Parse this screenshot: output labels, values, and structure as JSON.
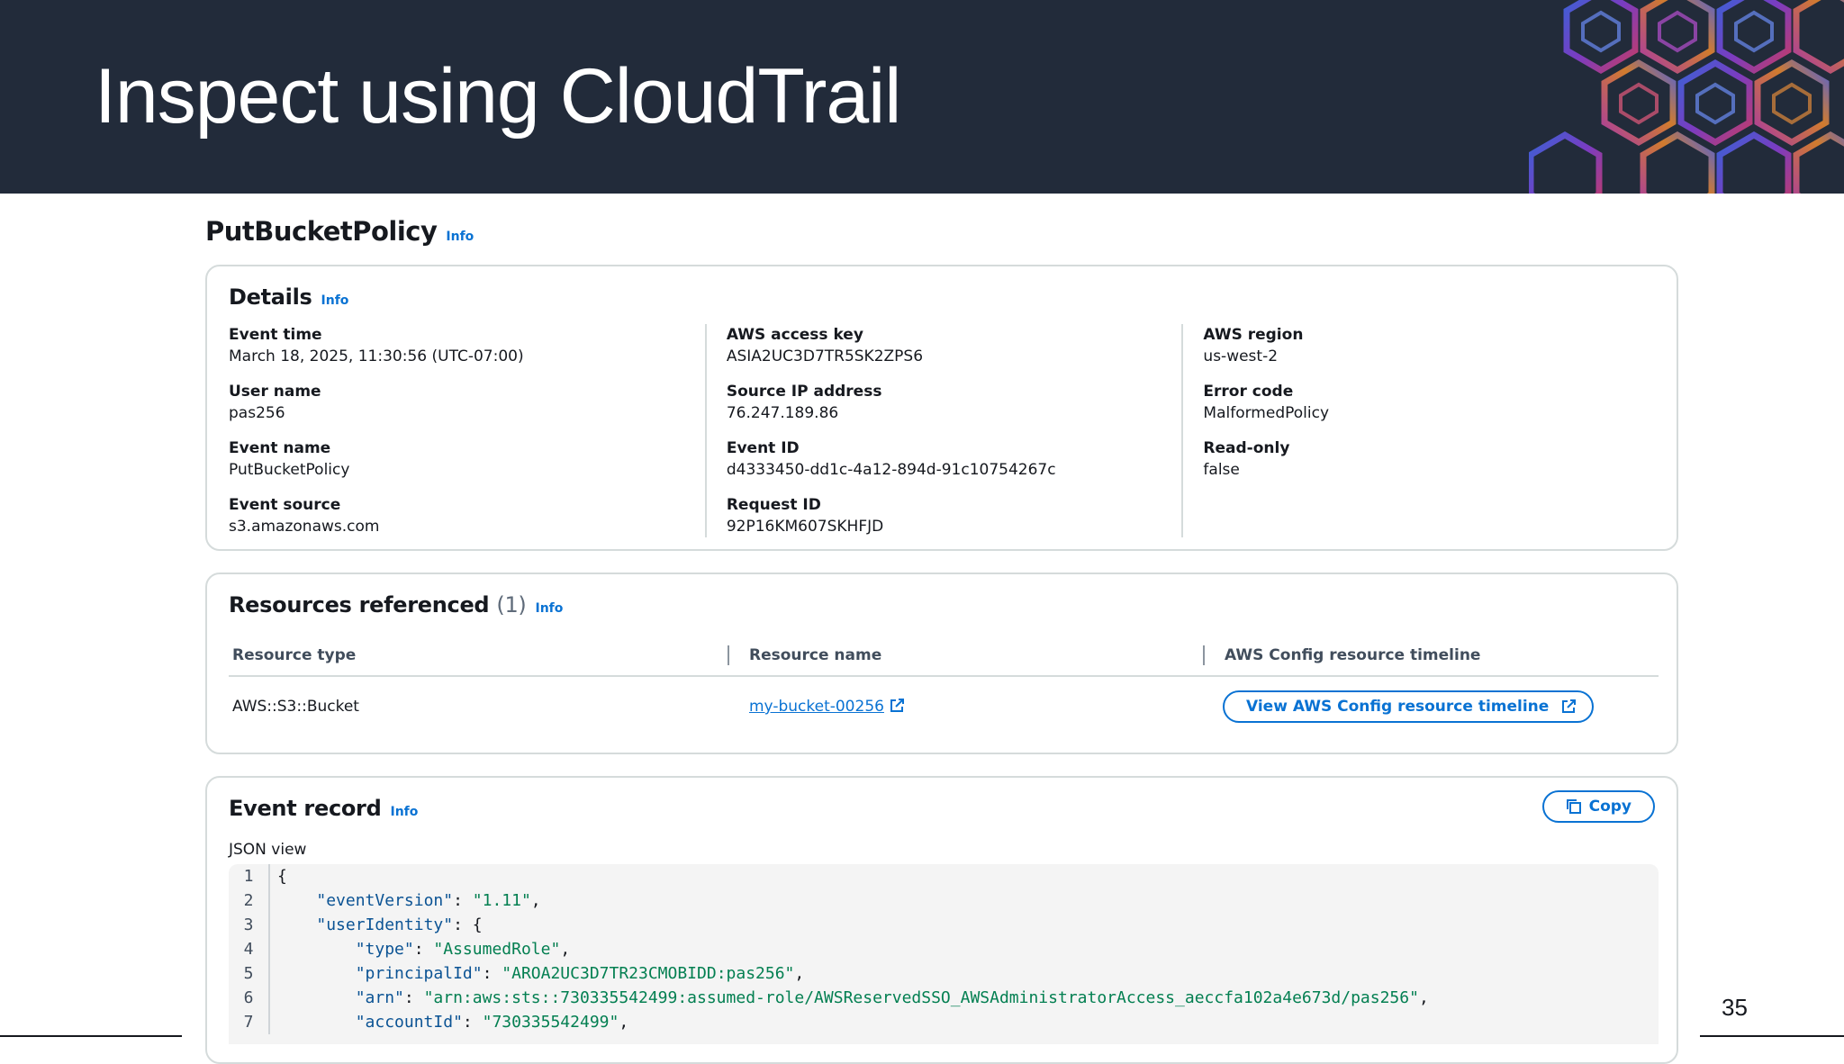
{
  "slide": {
    "title": "Inspect using CloudTrail",
    "page_number": "35"
  },
  "event": {
    "heading": "PutBucketPolicy",
    "info_label": "Info"
  },
  "details": {
    "title": "Details",
    "info_label": "Info",
    "columns": [
      [
        {
          "label": "Event time",
          "value": "March 18, 2025, 11:30:56 (UTC-07:00)"
        },
        {
          "label": "User name",
          "value": "pas256"
        },
        {
          "label": "Event name",
          "value": "PutBucketPolicy"
        },
        {
          "label": "Event source",
          "value": "s3.amazonaws.com"
        }
      ],
      [
        {
          "label": "AWS access key",
          "value": "ASIA2UC3D7TR5SK2ZPS6"
        },
        {
          "label": "Source IP address",
          "value": "76.247.189.86"
        },
        {
          "label": "Event ID",
          "value": "d4333450-dd1c-4a12-894d-91c10754267c"
        },
        {
          "label": "Request ID",
          "value": "92P16KM607SKHFJD"
        }
      ],
      [
        {
          "label": "AWS region",
          "value": "us-west-2"
        },
        {
          "label": "Error code",
          "value": "MalformedPolicy"
        },
        {
          "label": "Read-only",
          "value": "false"
        }
      ]
    ]
  },
  "resources": {
    "title": "Resources referenced",
    "count": "(1)",
    "info_label": "Info",
    "columns": [
      "Resource type",
      "Resource name",
      "AWS Config resource timeline"
    ],
    "rows": [
      {
        "type": "AWS::S3::Bucket",
        "name": "my-bucket-00256",
        "action": "View AWS Config resource timeline"
      }
    ]
  },
  "event_record": {
    "title": "Event record",
    "info_label": "Info",
    "copy_label": "Copy",
    "view_label": "JSON view",
    "lines": [
      {
        "n": "1",
        "indent": "",
        "key": "",
        "sep": "",
        "val": "",
        "tail": "{"
      },
      {
        "n": "2",
        "indent": "    ",
        "key": "\"eventVersion\"",
        "sep": ": ",
        "val": "\"1.11\"",
        "tail": ","
      },
      {
        "n": "3",
        "indent": "    ",
        "key": "\"userIdentity\"",
        "sep": ": ",
        "val": "",
        "tail": "{"
      },
      {
        "n": "4",
        "indent": "        ",
        "key": "\"type\"",
        "sep": ": ",
        "val": "\"AssumedRole\"",
        "tail": ","
      },
      {
        "n": "5",
        "indent": "        ",
        "key": "\"principalId\"",
        "sep": ": ",
        "val": "\"AROA2UC3D7TR23CMOBIDD:pas256\"",
        "tail": ","
      },
      {
        "n": "6",
        "indent": "        ",
        "key": "\"arn\"",
        "sep": ": ",
        "val": "\"arn:aws:sts::730335542499:assumed-role/AWSReservedSSO_AWSAdministratorAccess_aeccfa102a4e673d/pas256\"",
        "tail": ","
      },
      {
        "n": "7",
        "indent": "        ",
        "key": "\"accountId\"",
        "sep": ": ",
        "val": "\"730335542499\"",
        "tail": ","
      }
    ]
  },
  "colors": {
    "banner": "#222b3a",
    "link": "#0972d3",
    "json_key": "#0b5394",
    "json_string": "#037f51"
  }
}
